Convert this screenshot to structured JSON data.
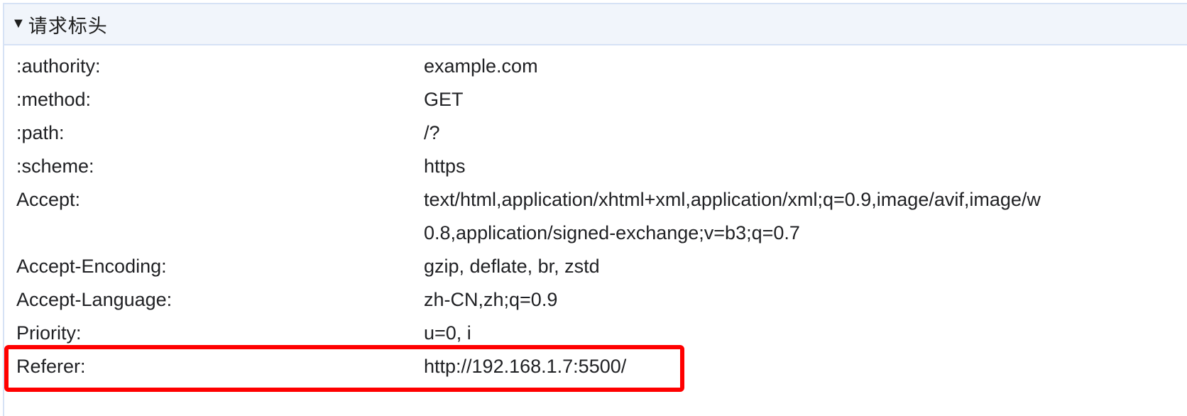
{
  "section": {
    "toggle_glyph": "▼",
    "title": "请求标头"
  },
  "headers": [
    {
      "key": ":authority:",
      "value": "example.com"
    },
    {
      "key": ":method:",
      "value": "GET"
    },
    {
      "key": ":path:",
      "value": "/?"
    },
    {
      "key": ":scheme:",
      "value": "https"
    },
    {
      "key": "Accept:",
      "value_lines": [
        "text/html,application/xhtml+xml,application/xml;q=0.9,image/avif,image/w",
        "0.8,application/signed-exchange;v=b3;q=0.7"
      ]
    },
    {
      "key": "Accept-Encoding:",
      "value": "gzip, deflate, br, zstd"
    },
    {
      "key": "Accept-Language:",
      "value": "zh-CN,zh;q=0.9"
    },
    {
      "key": "Priority:",
      "value": "u=0, i"
    },
    {
      "key": "Referer:",
      "value": "http://192.168.1.7:5500/"
    }
  ],
  "highlight_color": "#ff0000"
}
